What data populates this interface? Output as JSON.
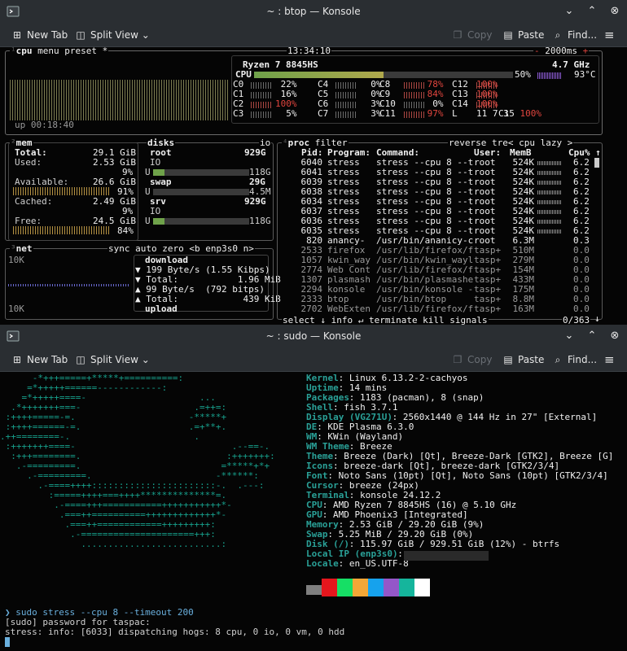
{
  "win1": {
    "title": "~ : btop — Konsole"
  },
  "win2": {
    "title": "~ : sudo — Konsole"
  },
  "toolbar": {
    "new_tab": "New Tab",
    "split_view": "Split View",
    "copy": "Copy",
    "paste": "Paste",
    "find": "Find..."
  },
  "btop": {
    "cpu_hdr": "cpu",
    "menu_hdr": "menu",
    "preset_hdr": "preset *",
    "clock": "13:34:10",
    "refresh": "2000ms",
    "cpu_name": "Ryzen 7 8845HS",
    "freq": "4.7 GHz",
    "temp": "93°C",
    "uptime": "up 00:18:40",
    "cpu_total": {
      "label": "CPU",
      "pct": "50%",
      "fraction": 0.5
    },
    "cores": [
      [
        "C0",
        " 22%",
        "C4",
        "  0%",
        "C8",
        " 78%",
        "C12",
        "100%"
      ],
      [
        "C1",
        " 16%",
        "C5",
        "  0%",
        "C9",
        " 84%",
        "C13",
        "100%"
      ],
      [
        "C2",
        "100%",
        "C6",
        "  3%",
        "C10",
        "  0%",
        "C14",
        "100%"
      ],
      [
        "C3",
        "  5%",
        "C7",
        "  3%",
        "C11",
        " 97%",
        "L",
        "11 7 3"
      ]
    ],
    "c15": "100%",
    "mem": {
      "hdr": "mem",
      "total_l": "Total:",
      "total": "29.1 GiB",
      "used_l": "Used:",
      "used": "2.53 GiB",
      "used_p": "9%",
      "avail_l": "Available:",
      "avail": "26.6 GiB",
      "avail_p": "91%",
      "cached_l": "Cached:",
      "cached": "2.49 GiB",
      "cached_p": "9%",
      "free_l": "Free:",
      "free": "24.5 GiB",
      "free_p": "84%"
    },
    "disks": {
      "hdr": "disks",
      "io_tag": "io",
      "root_l": "root",
      "root": "929G",
      "io1": "IO",
      "u1": "U",
      "u1v": "118G",
      "swap_l": "swap",
      "swap": "29G",
      "u2": "U",
      "u2v": "4.5M",
      "srv_l": "srv",
      "srv": "929G",
      "io2": "IO",
      "u3": "U",
      "u3v": "118G"
    },
    "net": {
      "hdr": "net",
      "sync": "sync",
      "auto": "auto",
      "zero": "zero",
      "iface": "<b enp3s0 n>",
      "top_scale": "10K",
      "bot_scale": "10K",
      "download": "download",
      "d1": "▼ 199 Byte/s (1.55 Kibps)",
      "d2": "▼ Total:           1.96 MiB",
      "u1": "▲ 99 Byte/s  (792 bitps)",
      "u2": "▲ Total:            439 KiB",
      "upload": "upload"
    },
    "proc": {
      "hdr": "proc",
      "filter": "filter",
      "reverse": "reverse",
      "tree": "tre",
      "sort": "< cpu lazy >",
      "col_pid": "Pid:",
      "col_prog": "Program:",
      "col_cmd": "Command:",
      "col_user": "User:",
      "col_mem": "MemB",
      "col_cpu": "Cpu%",
      "footer": "select ↓ info ↵ terminate kill signals",
      "count": "0/363",
      "rows": [
        [
          "6040",
          "stress",
          "stress --cpu 8 --t",
          "root",
          "524K",
          "6.2"
        ],
        [
          "6041",
          "stress",
          "stress --cpu 8 --t",
          "root",
          "524K",
          "6.2"
        ],
        [
          "6039",
          "stress",
          "stress --cpu 8 --t",
          "root",
          "524K",
          "6.2"
        ],
        [
          "6038",
          "stress",
          "stress --cpu 8 --t",
          "root",
          "524K",
          "6.2"
        ],
        [
          "6034",
          "stress",
          "stress --cpu 8 --t",
          "root",
          "524K",
          "6.2"
        ],
        [
          "6037",
          "stress",
          "stress --cpu 8 --t",
          "root",
          "524K",
          "6.2"
        ],
        [
          "6036",
          "stress",
          "stress --cpu 8 --t",
          "root",
          "524K",
          "6.2"
        ],
        [
          "6035",
          "stress",
          "stress --cpu 8 --t",
          "root",
          "524K",
          "6.2"
        ],
        [
          "820",
          "anancy-",
          "/usr/bin/ananicy-c",
          "root",
          "6.3M",
          "0.3"
        ],
        [
          "2533",
          "firefox",
          "/usr/lib/firefox/f",
          "tasp+",
          "510M",
          "0.0"
        ],
        [
          "1057",
          "kwin_way",
          "/usr/bin/kwin_wayl",
          "tasp+",
          "279M",
          "0.0"
        ],
        [
          "2774",
          "Web Cont",
          "/usr/lib/firefox/f",
          "tasp+",
          "154M",
          "0.0"
        ],
        [
          "1307",
          "plasmash",
          "/usr/bin/plasmashe",
          "tasp+",
          "433M",
          "0.0"
        ],
        [
          "2294",
          "konsole",
          "/usr/bin/konsole -",
          "tasp+",
          "175M",
          "0.0"
        ],
        [
          "2333",
          "btop",
          "/usr/bin/btop",
          "tasp+",
          "8.8M",
          "0.0"
        ],
        [
          "2702",
          "WebExten",
          "/usr/lib/firefox/f",
          "tasp+",
          "163M",
          "0.0"
        ]
      ]
    }
  },
  "ff": {
    "logo": [
      "      -*+++=====+*****+==========:",
      "     =*+++++======------------:",
      "    =*+++++====-                     ...",
      "  .*+++++++===-                     .=++=:",
      " :++++=====-=.                     -*****+",
      " :++++======-=.                    .=+**+.",
      ".++========-.                       .",
      " :+++++++====-                             .--==-.",
      "  :+++========.                           :+++++++:",
      "   .-=========.                          =*****+*+",
      "     .-=========.                       -******:",
      "       .-====++++:::::::::::::::::::::::-.  .---:",
      "         :=====++++===++++**************=.",
      "          .-====+++===========+++++++++++*-",
      "           .===++==========+++++++++++++*-",
      "            .===++============+++++++++:",
      "             .-=====================+++:",
      "               ..........................:"
    ],
    "info": [
      [
        "Kernel",
        ": Linux 6.13.2-2-cachyos"
      ],
      [
        "Uptime",
        ": 14 mins"
      ],
      [
        "Packages",
        ": 1183 (pacman), 8 (snap)"
      ],
      [
        "Shell",
        ": fish 3.7.1"
      ],
      [
        "Display (VG271U)",
        ": 2560x1440 @ 144 Hz in 27\" [External]"
      ],
      [
        "DE",
        ": KDE Plasma 6.3.0"
      ],
      [
        "WM",
        ": KWin (Wayland)"
      ],
      [
        "WM Theme",
        ": Breeze"
      ],
      [
        "Theme",
        ": Breeze (Dark) [Qt], Breeze-Dark [GTK2], Breeze [G]"
      ],
      [
        "Icons",
        ": breeze-dark [Qt], breeze-dark [GTK2/3/4]"
      ],
      [
        "Font",
        ": Noto Sans (10pt) [Qt], Noto Sans (10pt) [GTK2/3/4]"
      ],
      [
        "Cursor",
        ": breeze (24px)"
      ],
      [
        "Terminal",
        ": konsole 24.12.2"
      ],
      [
        "CPU",
        ": AMD Ryzen 7 8845HS (16) @ 5.10 GHz"
      ],
      [
        "GPU",
        ": AMD Phoenix3 [Integrated]"
      ],
      [
        "Memory",
        ": 2.53 GiB / 29.20 GiB (9%)"
      ],
      [
        "Swap",
        ": 5.25 MiB / 29.20 GiB (0%)"
      ],
      [
        "Disk (/)",
        ": 115.97 GiB / 929.51 GiB (12%) - btrfs"
      ],
      [
        "Local IP (enp3s0)",
        ":"
      ],
      [
        "Locale",
        ": en_US.UTF-8"
      ]
    ],
    "swatches": [
      "#7f7f7f",
      "#e5161d",
      "#16df65",
      "#f3a737",
      "#16a2ed",
      "#9457c8",
      "#15b59c",
      "#ffffff"
    ],
    "cmd": "❯ sudo stress --cpu 8 --timeout 200",
    "pw": "[sudo] password for taspac:",
    "out": "stress: info: [6033] dispatching hogs: 8 cpu, 0 io, 0 vm, 0 hdd"
  }
}
